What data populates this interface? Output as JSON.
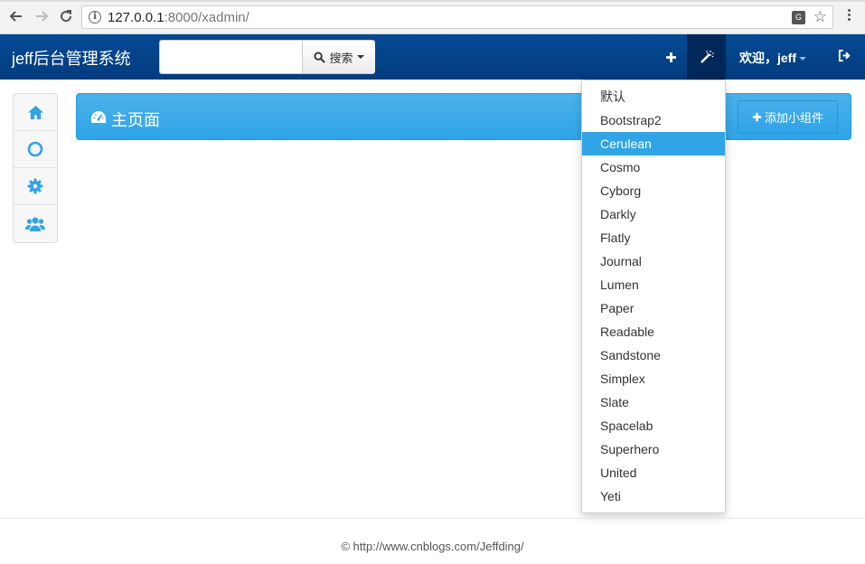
{
  "browser": {
    "url_host": "127.0.0.1",
    "url_rest": ":8000/xadmin/"
  },
  "navbar": {
    "brand": "jeff后台管理系统",
    "search_placeholder": "",
    "search_label": "搜索",
    "welcome": "欢迎，jeff"
  },
  "sidebar": {
    "items": [
      {
        "icon": "home-icon"
      },
      {
        "icon": "circle-icon"
      },
      {
        "icon": "gear-icon"
      },
      {
        "icon": "users-icon"
      }
    ]
  },
  "main": {
    "title": "主页面",
    "add_widget": "添加小组件"
  },
  "theme_menu": {
    "items": [
      "默认",
      "Bootstrap2",
      "Cerulean",
      "Cosmo",
      "Cyborg",
      "Darkly",
      "Flatly",
      "Journal",
      "Lumen",
      "Paper",
      "Readable",
      "Sandstone",
      "Simplex",
      "Slate",
      "Spacelab",
      "Superhero",
      "United",
      "Yeti"
    ],
    "active": "Cerulean"
  },
  "footer": {
    "text": "© http://www.cnblogs.com/Jeffding/"
  },
  "colors": {
    "navbar": "#033c7e",
    "accent": "#2fa4e7",
    "icon_blue": "#2fa4e7"
  }
}
